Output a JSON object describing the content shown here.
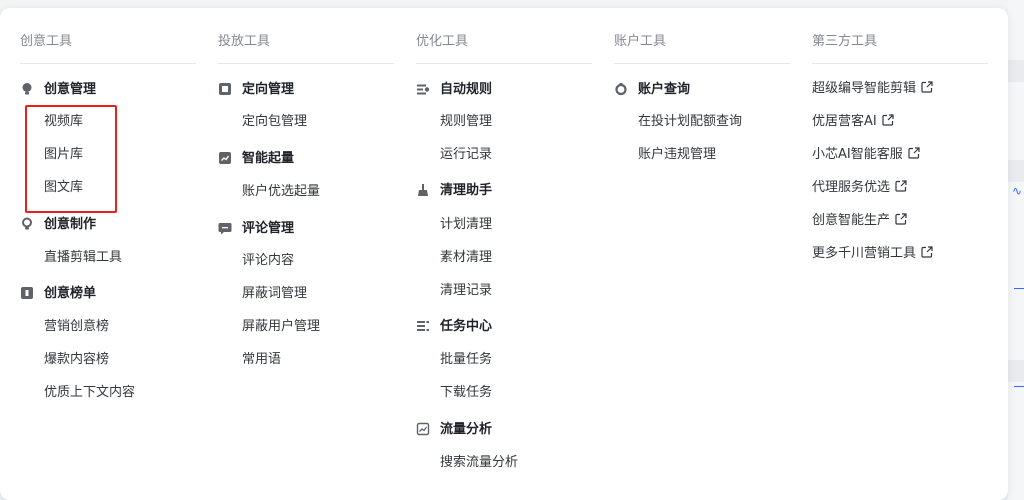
{
  "columns": [
    {
      "header": "创意工具",
      "groups": [
        {
          "icon": "bulb-icon",
          "label": "创意管理",
          "items": [
            "视频库",
            "图片库",
            "图文库"
          ]
        },
        {
          "icon": "bulb-outline-icon",
          "label": "创意制作",
          "items": [
            "直播剪辑工具"
          ]
        },
        {
          "icon": "ranking-icon",
          "label": "创意榜单",
          "items": [
            "营销创意榜",
            "爆款内容榜",
            "优质上下文内容"
          ]
        }
      ]
    },
    {
      "header": "投放工具",
      "groups": [
        {
          "icon": "target-package-icon",
          "label": "定向管理",
          "items": [
            "定向包管理"
          ]
        },
        {
          "icon": "trend-chart-icon",
          "label": "智能起量",
          "items": [
            "账户优选起量"
          ]
        },
        {
          "icon": "comment-icon",
          "label": "评论管理",
          "items": [
            "评论内容",
            "屏蔽词管理",
            "屏蔽用户管理",
            "常用语"
          ]
        }
      ]
    },
    {
      "header": "优化工具",
      "groups": [
        {
          "icon": "rule-icon",
          "label": "自动规则",
          "items": [
            "规则管理",
            "运行记录"
          ]
        },
        {
          "icon": "broom-icon",
          "label": "清理助手",
          "items": [
            "计划清理",
            "素材清理",
            "清理记录"
          ]
        },
        {
          "icon": "task-list-icon",
          "label": "任务中心",
          "items": [
            "批量任务",
            "下载任务"
          ]
        },
        {
          "icon": "analytics-icon",
          "label": "流量分析",
          "items": [
            "搜索流量分析"
          ]
        }
      ]
    },
    {
      "header": "账户工具",
      "groups": [
        {
          "icon": "account-search-icon",
          "label": "账户查询",
          "items": [
            "在投计划配额查询",
            "账户违规管理"
          ]
        }
      ]
    },
    {
      "header": "第三方工具",
      "links": [
        "超级编导智能剪辑",
        "优居营客AI",
        "小芯AI智能客服",
        "代理服务优选",
        "创意智能生产",
        "更多千川营销工具"
      ]
    }
  ],
  "colors": {
    "highlight": "#e8201c",
    "accent": "#2f6bff"
  }
}
